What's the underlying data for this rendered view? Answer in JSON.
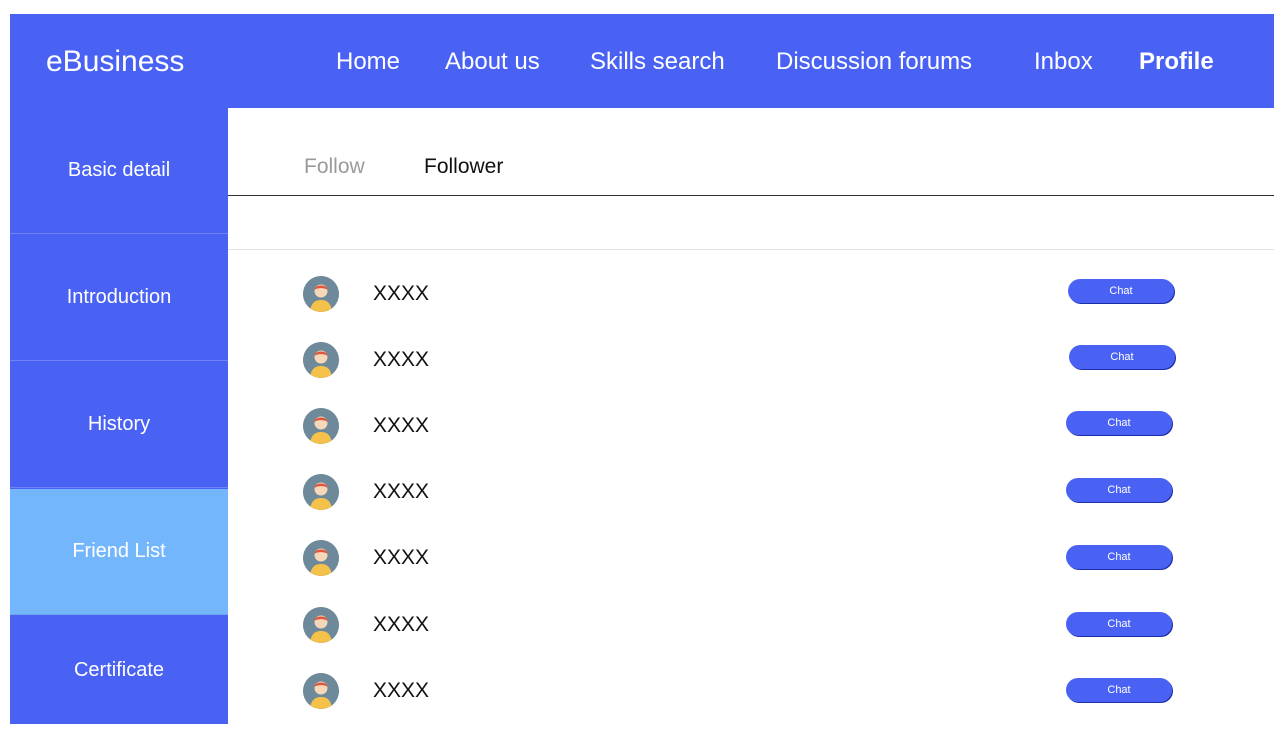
{
  "header": {
    "logo": "eBusiness",
    "nav": [
      {
        "label": "Home",
        "active": false
      },
      {
        "label": "About us",
        "active": false
      },
      {
        "label": "Skills search",
        "active": false
      },
      {
        "label": "Discussion forums",
        "active": false
      },
      {
        "label": "Inbox",
        "active": false
      },
      {
        "label": "Profile",
        "active": true
      }
    ]
  },
  "sidebar": {
    "items": [
      {
        "label": "Basic detail",
        "active": false
      },
      {
        "label": "Introduction",
        "active": false
      },
      {
        "label": "History",
        "active": false
      },
      {
        "label": "Friend List",
        "active": true
      },
      {
        "label": "Certificate",
        "active": false
      }
    ]
  },
  "tabs": [
    {
      "label": "Follow",
      "active": false
    },
    {
      "label": "Follower",
      "active": true
    }
  ],
  "friends": [
    {
      "name": "XXXX",
      "avatar": "person-avatar-icon",
      "action": "Chat"
    },
    {
      "name": "XXXX",
      "avatar": "person-avatar-icon",
      "action": "Chat"
    },
    {
      "name": "XXXX",
      "avatar": "person-avatar-icon",
      "action": "Chat"
    },
    {
      "name": "XXXX",
      "avatar": "person-avatar-icon",
      "action": "Chat"
    },
    {
      "name": "XXXX",
      "avatar": "person-avatar-icon",
      "action": "Chat"
    },
    {
      "name": "XXXX",
      "avatar": "person-avatar-icon",
      "action": "Chat"
    },
    {
      "name": "XXXX",
      "avatar": "person-avatar-icon",
      "action": "Chat"
    }
  ],
  "colors": {
    "primary": "#4a62f3",
    "sidebar_active": "#74b6fb"
  }
}
